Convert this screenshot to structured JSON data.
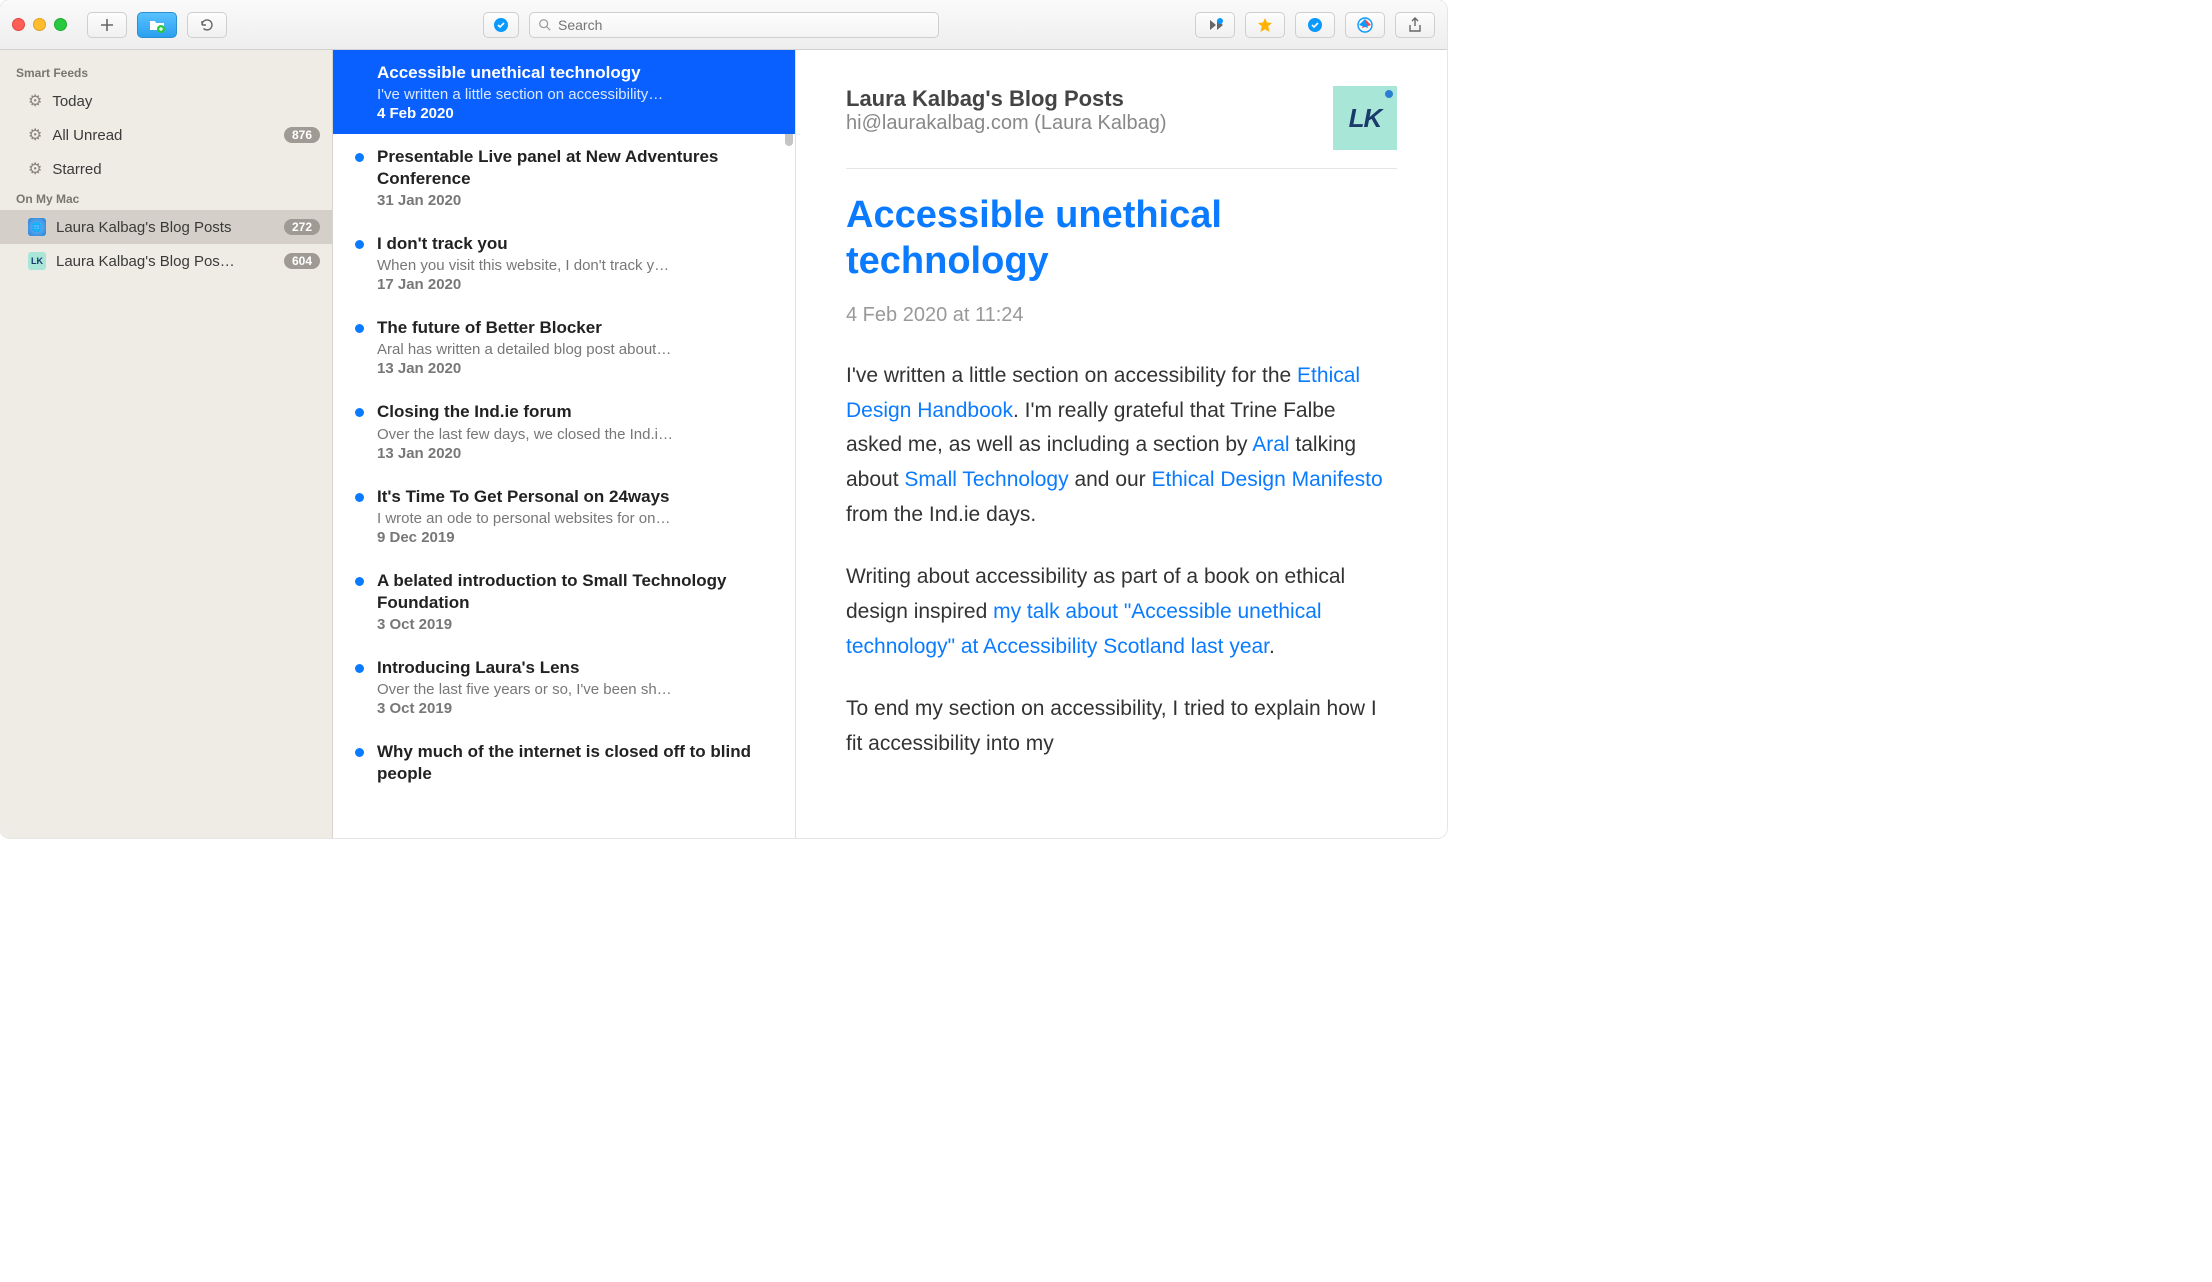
{
  "toolbar": {
    "search_placeholder": "Search"
  },
  "sidebar": {
    "smart_feeds_header": "Smart Feeds",
    "today": "Today",
    "all_unread": "All Unread",
    "all_unread_count": "876",
    "starred": "Starred",
    "on_my_mac_header": "On My Mac",
    "feed1_label": "Laura Kalbag's Blog Posts",
    "feed1_count": "272",
    "feed2_label": "Laura Kalbag's Blog Pos…",
    "feed2_count": "604"
  },
  "list": [
    {
      "title": "Accessible unethical technology",
      "summary": "I've written a little section on accessibility…",
      "date": "4 Feb 2020",
      "unread": false,
      "selected": true
    },
    {
      "title": "Presentable Live panel at New Adventures Conference",
      "summary": "",
      "date": "31 Jan 2020",
      "unread": true,
      "selected": false
    },
    {
      "title": "I don't track you",
      "summary": "When you visit this website, I don't track y…",
      "date": "17 Jan 2020",
      "unread": true,
      "selected": false
    },
    {
      "title": "The future of Better Blocker",
      "summary": "Aral has written a detailed blog post about…",
      "date": "13 Jan 2020",
      "unread": true,
      "selected": false
    },
    {
      "title": "Closing the Ind.ie forum",
      "summary": "Over the last few days, we closed the Ind.i…",
      "date": "13 Jan 2020",
      "unread": true,
      "selected": false
    },
    {
      "title": "It's Time To Get Personal on 24ways",
      "summary": "I wrote an ode to personal websites for on…",
      "date": "9 Dec 2019",
      "unread": true,
      "selected": false
    },
    {
      "title": "A belated introduction to Small Technology Foundation",
      "summary": "",
      "date": "3 Oct 2019",
      "unread": true,
      "selected": false
    },
    {
      "title": "Introducing Laura's Lens",
      "summary": "Over the last five years or so, I've been sh…",
      "date": "3 Oct 2019",
      "unread": true,
      "selected": false
    },
    {
      "title": "Why much of the internet is closed off to blind people",
      "summary": "",
      "date": "",
      "unread": true,
      "selected": false
    }
  ],
  "reader": {
    "feed_name": "Laura Kalbag's Blog Posts",
    "author": "hi@laurakalbag.com (Laura Kalbag)",
    "title": "Accessible unethical technology",
    "datetime": "4 Feb 2020 at 11:24",
    "avatar_text": "LK",
    "p1_a": "I've written a little section on accessibility for the ",
    "p1_link1": "Ethical Design Handbook",
    "p1_b": ". I'm really grateful that Trine Falbe asked me, as well as including a section by ",
    "p1_link2": "Aral",
    "p1_c": " talking about ",
    "p1_link3": "Small Technology",
    "p1_d": " and our ",
    "p1_link4": "Ethical Design Manifesto",
    "p1_e": " from the Ind.ie days.",
    "p2_a": "Writing about accessibility as part of a book on ethical design inspired ",
    "p2_link1": "my talk about \"Accessible unethical technology\" at Accessibility Scotland last year",
    "p2_b": ".",
    "p3": "To end my section on accessibility, I tried to explain how I fit accessibility into my"
  }
}
